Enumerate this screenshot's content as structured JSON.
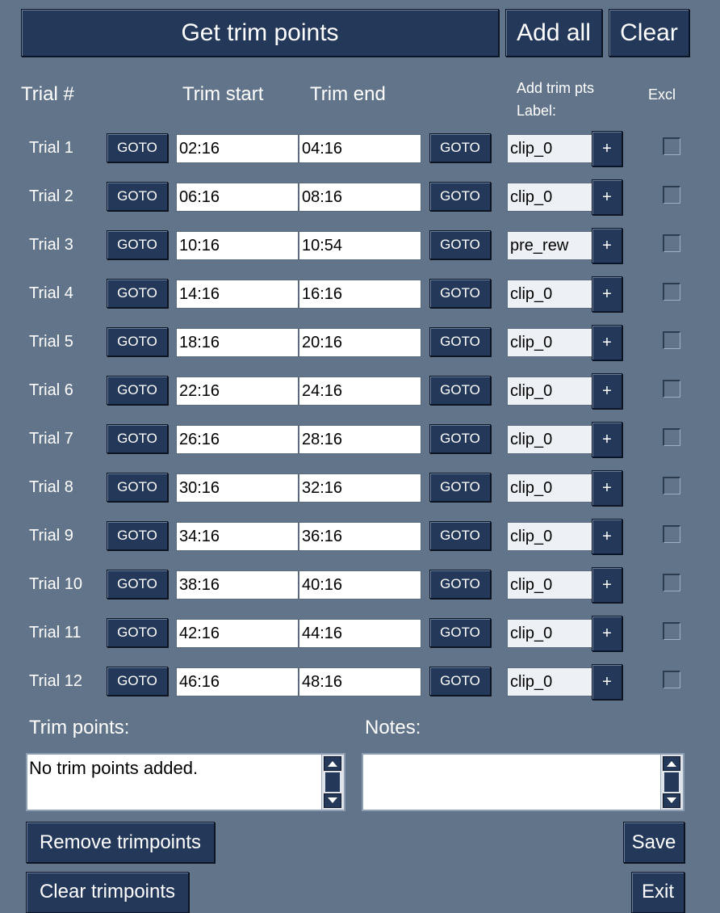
{
  "toolbar": {
    "get_trim_points": "Get trim points",
    "add_all": "Add all",
    "clear": "Clear"
  },
  "headers": {
    "trial": "Trial #",
    "trim_start": "Trim start",
    "trim_end": "Trim end",
    "add_trim_pts": "Add trim pts",
    "label": "Label:",
    "exclude": "Excl"
  },
  "goto_label": "GOTO",
  "plus_label": "+",
  "trials": [
    {
      "label": "Trial 1",
      "start": "02:16",
      "end": "04:16",
      "clip": "clip_0",
      "excluded": false
    },
    {
      "label": "Trial 2",
      "start": "06:16",
      "end": "08:16",
      "clip": "clip_0",
      "excluded": false
    },
    {
      "label": "Trial 3",
      "start": "10:16",
      "end": "10:54",
      "clip": "pre_rew",
      "excluded": false
    },
    {
      "label": "Trial 4",
      "start": "14:16",
      "end": "16:16",
      "clip": "clip_0",
      "excluded": false
    },
    {
      "label": "Trial 5",
      "start": "18:16",
      "end": "20:16",
      "clip": "clip_0",
      "excluded": false
    },
    {
      "label": "Trial 6",
      "start": "22:16",
      "end": "24:16",
      "clip": "clip_0",
      "excluded": false
    },
    {
      "label": "Trial 7",
      "start": "26:16",
      "end": "28:16",
      "clip": "clip_0",
      "excluded": false
    },
    {
      "label": "Trial 8",
      "start": "30:16",
      "end": "32:16",
      "clip": "clip_0",
      "excluded": false
    },
    {
      "label": "Trial 9",
      "start": "34:16",
      "end": "36:16",
      "clip": "clip_0",
      "excluded": false
    },
    {
      "label": "Trial 10",
      "start": "38:16",
      "end": "40:16",
      "clip": "clip_0",
      "excluded": false
    },
    {
      "label": "Trial 11",
      "start": "42:16",
      "end": "44:16",
      "clip": "clip_0",
      "excluded": false
    },
    {
      "label": "Trial 12",
      "start": "46:16",
      "end": "48:16",
      "clip": "clip_0",
      "excluded": false
    }
  ],
  "trim_points": {
    "title": "Trim points:",
    "value": "No trim points added."
  },
  "notes": {
    "title": "Notes:",
    "value": ""
  },
  "actions": {
    "remove_trimpoints": "Remove trimpoints",
    "save": "Save",
    "clear_trimpoints": "Clear trimpoints",
    "exit": "Exit"
  },
  "icons": {
    "scroll_up": "triangle-up-icon",
    "scroll_down": "triangle-down-icon"
  },
  "colors": {
    "background": "#627489",
    "button": "#24385a",
    "label_field": "#edf0f4"
  }
}
